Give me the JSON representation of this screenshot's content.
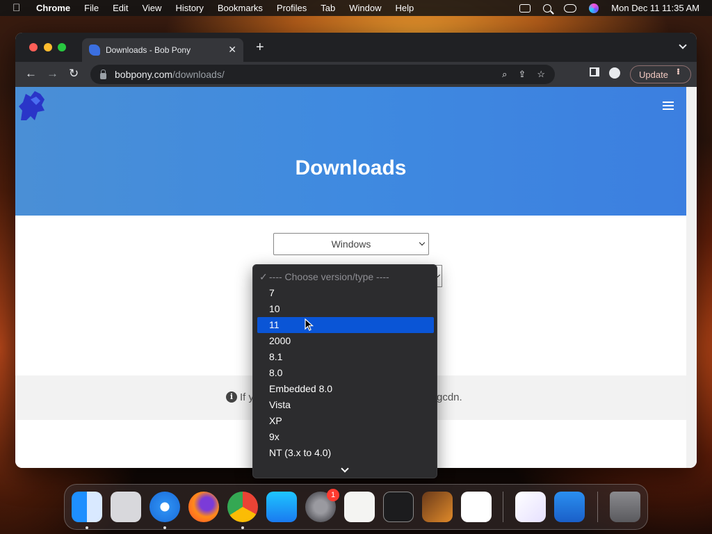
{
  "menubar": {
    "app": "Chrome",
    "items": [
      "File",
      "Edit",
      "View",
      "History",
      "Bookmarks",
      "Profiles",
      "Tab",
      "Window",
      "Help"
    ],
    "clock": "Mon Dec 11  11:35 AM"
  },
  "browser": {
    "tab_title": "Downloads - Bob Pony",
    "url_host": "bobpony.com",
    "url_path": "/downloads/",
    "update_label": "Update"
  },
  "page": {
    "title": "Downloads",
    "os_select_value": "Windows",
    "notice_left": "If y",
    "notice_right": "gcdn."
  },
  "dropdown": {
    "header": "---- Choose version/type ----",
    "options": [
      "7",
      "10",
      "11",
      "2000",
      "8.1",
      "8.0",
      "Embedded 8.0",
      "Vista",
      "XP",
      "9x",
      "NT (3.x to 4.0)"
    ],
    "selected": "11"
  },
  "dock": {
    "apps": [
      "finder-icon",
      "launchpad-icon",
      "safari-icon",
      "firefox-icon",
      "chrome-icon",
      "app-store-icon",
      "system-settings-icon",
      "textedit-icon",
      "terminal-icon",
      "garageband-icon",
      "vscode-icon",
      "visual-studio-icon",
      "weather-icon",
      "trash-icon"
    ],
    "settings_badge": "1"
  },
  "colors": {
    "hero_blue": "#3f8ae0",
    "selection_blue": "#0a55d6",
    "chrome_dark": "#35363a"
  }
}
